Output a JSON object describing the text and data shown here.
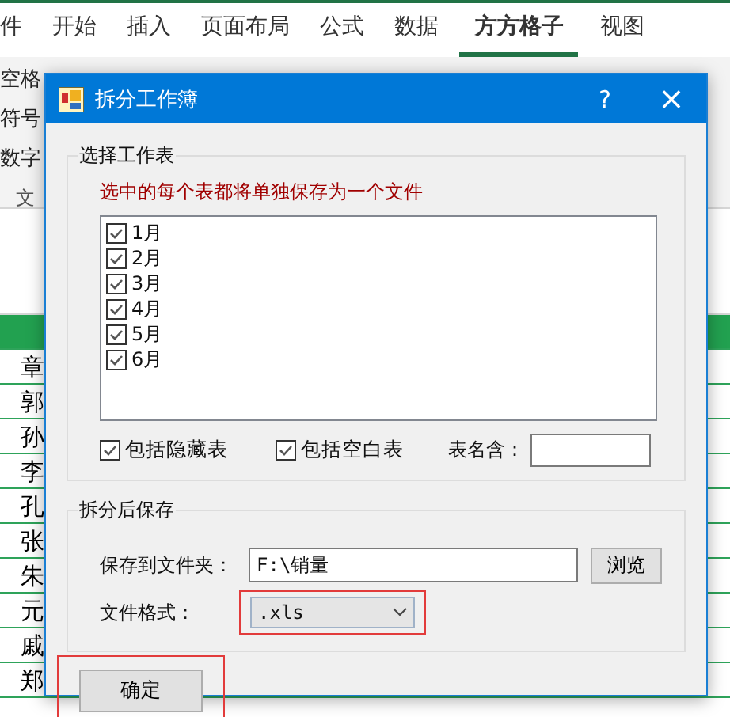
{
  "ribbon": {
    "tabs": [
      {
        "label": "件",
        "selected": false
      },
      {
        "label": "开始",
        "selected": false
      },
      {
        "label": "插入",
        "selected": false
      },
      {
        "label": "页面布局",
        "selected": false
      },
      {
        "label": "公式",
        "selected": false
      },
      {
        "label": "数据",
        "selected": false
      },
      {
        "label": "方方格子",
        "selected": true
      },
      {
        "label": "视图",
        "selected": false
      }
    ],
    "left_items": [
      "空格",
      "符号",
      "数字"
    ],
    "group_label": "文"
  },
  "sheet": {
    "names": [
      "章",
      "郭",
      "孙",
      "李",
      "孔",
      "张",
      "朱",
      "元",
      "戚",
      "郑"
    ]
  },
  "dialog": {
    "title": "拆分工作簿",
    "help": "?",
    "close": "×",
    "select_group": {
      "legend": "选择工作表",
      "note": "选中的每个表都将单独保存为一个文件",
      "sheets": [
        {
          "label": "1月",
          "checked": true
        },
        {
          "label": "2月",
          "checked": true
        },
        {
          "label": "3月",
          "checked": true
        },
        {
          "label": "4月",
          "checked": true
        },
        {
          "label": "5月",
          "checked": true
        },
        {
          "label": "6月",
          "checked": true
        }
      ],
      "options": [
        {
          "label": "包括隐藏表",
          "checked": true
        },
        {
          "label": "包括空白表",
          "checked": true
        }
      ],
      "name_filter_label": "表名含："
    },
    "save_group": {
      "legend": "拆分后保存",
      "folder_label": "保存到文件夹：",
      "folder_value": "F:\\销量",
      "browse": "浏览",
      "format_label": "文件格式：",
      "format_value": ".xls",
      "format_highlighted": true
    },
    "ok": {
      "label": "确定",
      "highlighted": true
    }
  }
}
